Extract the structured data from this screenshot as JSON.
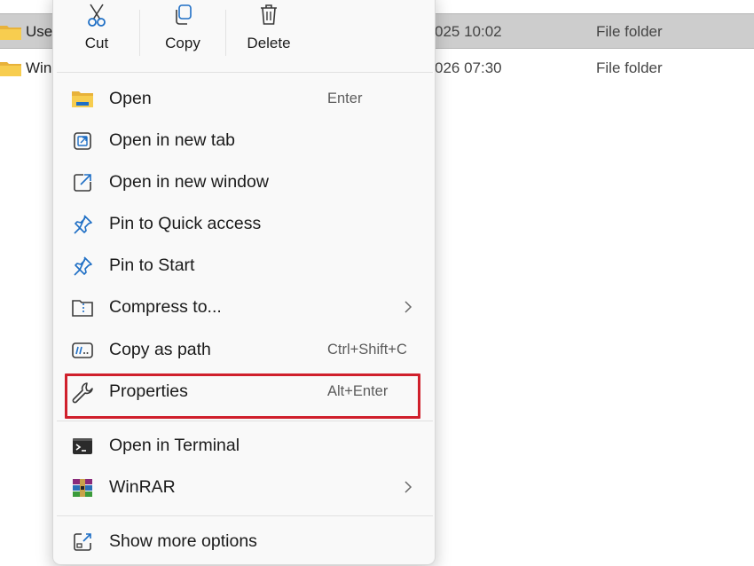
{
  "files": [
    {
      "name": "Use",
      "date": "025 10:02",
      "type": "File folder"
    },
    {
      "name": "Win",
      "date": "026 07:30",
      "type": "File folder"
    }
  ],
  "toolbar": {
    "cut": "Cut",
    "copy": "Copy",
    "delete": "Delete"
  },
  "menu": {
    "items": [
      {
        "label": "Open",
        "accel": "Enter"
      },
      {
        "label": "Open in new tab",
        "accel": ""
      },
      {
        "label": "Open in new window",
        "accel": ""
      },
      {
        "label": "Pin to Quick access",
        "accel": ""
      },
      {
        "label": "Pin to Start",
        "accel": ""
      },
      {
        "label": "Compress to...",
        "accel": ""
      },
      {
        "label": "Copy as path",
        "accel": "Ctrl+Shift+C"
      },
      {
        "label": "Properties",
        "accel": "Alt+Enter"
      },
      {
        "label": "Open in Terminal",
        "accel": ""
      },
      {
        "label": "WinRAR",
        "accel": ""
      },
      {
        "label": "Show more options",
        "accel": ""
      }
    ]
  },
  "colors": {
    "highlight_border": "#d0202c",
    "accent_blue": "#1f6fc5",
    "folder_yellow": "#f4c53f"
  }
}
